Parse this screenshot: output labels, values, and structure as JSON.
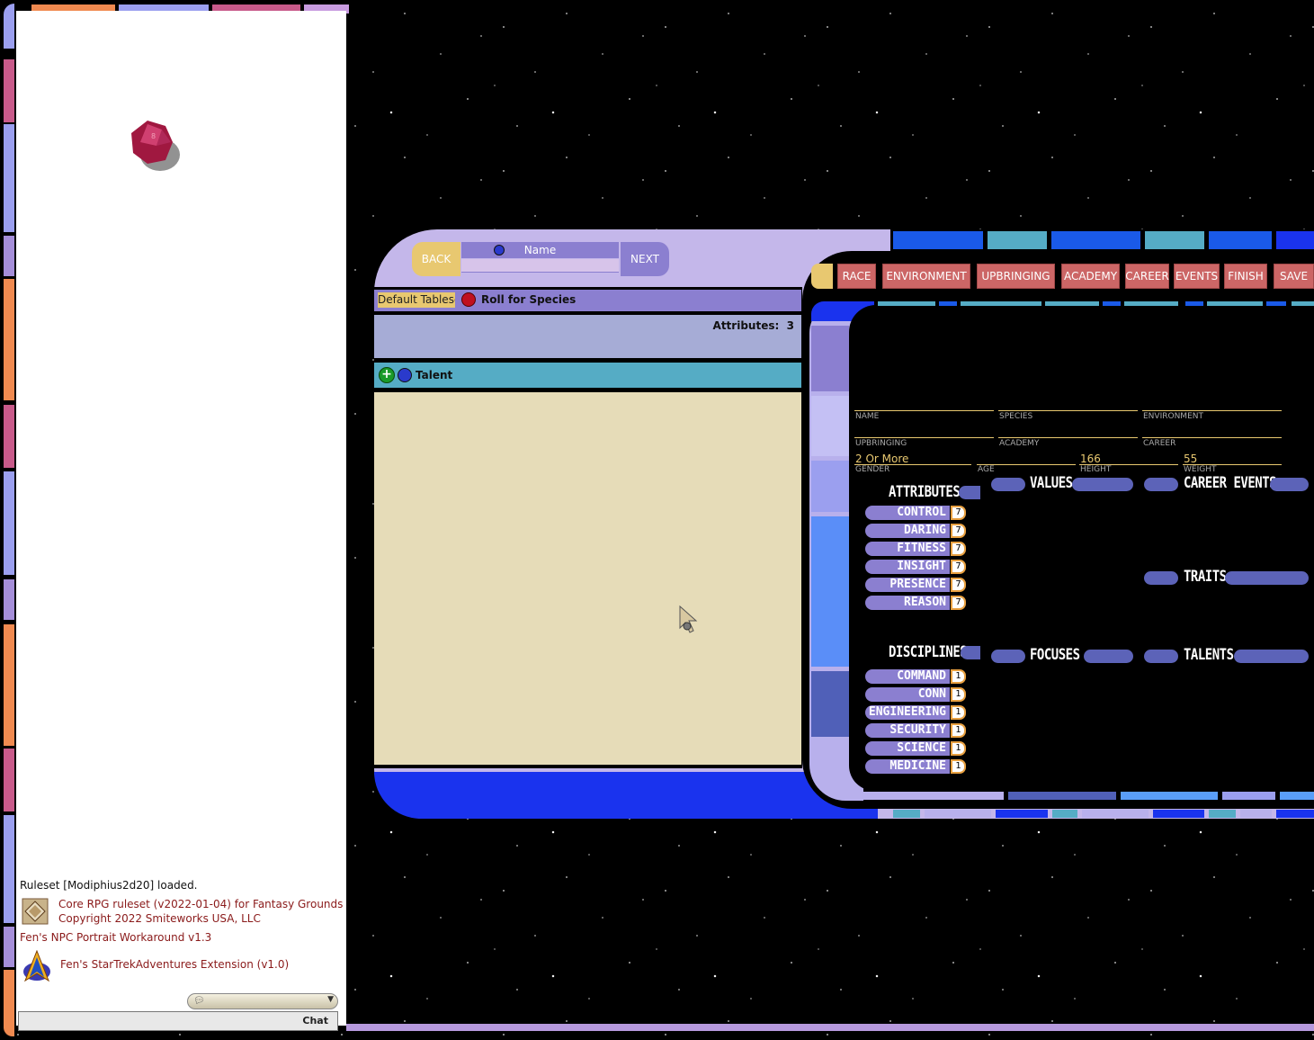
{
  "chat": {
    "messages": {
      "ruleset": "Ruleset [Modiphius2d20] loaded.",
      "core_line1": "Core RPG ruleset (v2022-01-04) for Fantasy Grounds",
      "core_line2": "Copyright 2022 Smiteworks USA, LLC",
      "portrait": "Fen's NPC Portrait Workaround v1.3",
      "extension": "Fen's StarTrekAdventures Extension (v1.0)"
    },
    "send_label": "Chat"
  },
  "wizard": {
    "back_label": "BACK",
    "next_label": "NEXT",
    "name_label": "Name",
    "tableset": "Default Tableset",
    "roll_label": "Roll for Species",
    "attributes_label": "Attributes:",
    "attributes_count": "3",
    "talent_label": "Talent"
  },
  "tabs": [
    "RACE",
    "ENVIRONMENT",
    "UPBRINGING",
    "ACADEMY",
    "CAREER",
    "EVENTS",
    "FINISH",
    "SAVE"
  ],
  "fields": {
    "name": "NAME",
    "species": "SPECIES",
    "environment": "ENVIRONMENT",
    "upbringing": "UPBRINGING",
    "academy": "ACADEMY",
    "career": "CAREER",
    "gender": "GENDER",
    "age": "AGE",
    "height": "HEIGHT",
    "weight": "WEIGHT",
    "gender_value": "2 Or More",
    "height_value": "166",
    "weight_value": "55"
  },
  "sections": {
    "attributes": "ATTRIBUTES",
    "values": "VALUES",
    "career_events": "CAREER EVENTS",
    "traits": "TRAITS",
    "disciplines": "DISCIPLINES",
    "focuses": "FOCUSES",
    "talents": "TALENTS"
  },
  "attributes": [
    {
      "name": "CONTROL",
      "value": "7"
    },
    {
      "name": "DARING",
      "value": "7"
    },
    {
      "name": "FITNESS",
      "value": "7"
    },
    {
      "name": "INSIGHT",
      "value": "7"
    },
    {
      "name": "PRESENCE",
      "value": "7"
    },
    {
      "name": "REASON",
      "value": "7"
    }
  ],
  "disciplines": [
    {
      "name": "COMMAND",
      "value": "1"
    },
    {
      "name": "CONN",
      "value": "1"
    },
    {
      "name": "ENGINEERING",
      "value": "1"
    },
    {
      "name": "SECURITY",
      "value": "1"
    },
    {
      "name": "SCIENCE",
      "value": "1"
    },
    {
      "name": "MEDICINE",
      "value": "1"
    }
  ],
  "colors": {
    "lcars_gold": "#e8c870",
    "lcars_purple": "#8b7fd0",
    "lcars_red": "#cc6666",
    "lcars_blue": "#1a33ee",
    "lcars_cyan": "#55acc5",
    "parchment": "#e6dcb8"
  }
}
